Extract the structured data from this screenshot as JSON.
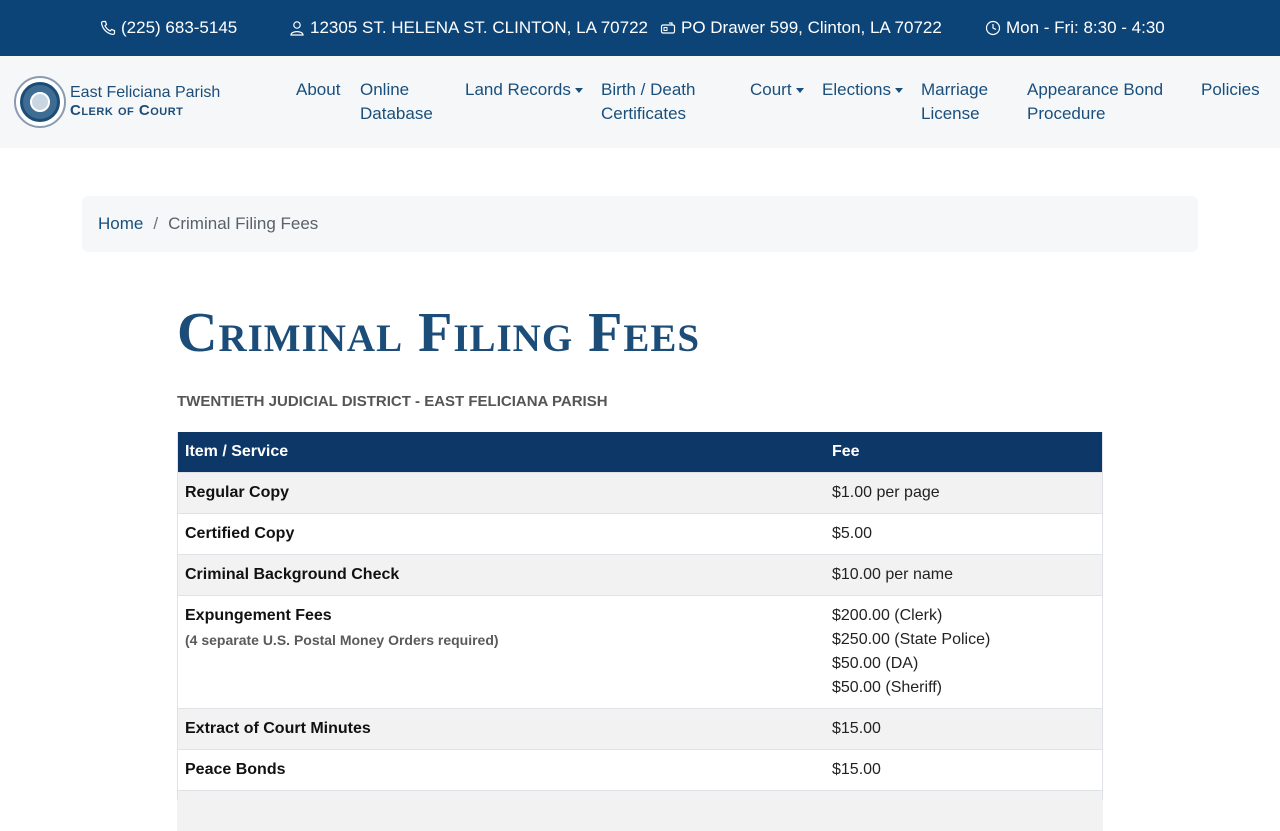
{
  "topbar": {
    "phone": "(225) 683-5145",
    "address": "12305 ST. HELENA ST. CLINTON, LA 70722",
    "mailing": "PO Drawer 599, Clinton, LA 70722",
    "hours": "Mon - Fri: 8:30 - 4:30"
  },
  "logo": {
    "line1": "East Feliciana Parish",
    "line2": "Clerk of Court"
  },
  "nav": {
    "about": "About",
    "online_database": "Online\nDatabase",
    "land_records": "Land Records",
    "birth_death": "Birth / Death\nCertificates",
    "court": "Court",
    "elections": "Elections",
    "marriage": "Marriage\nLicense",
    "appearance_bond": "Appearance Bond\nProcedure",
    "policies": "Policies"
  },
  "breadcrumb": {
    "home": "Home",
    "separator": "/",
    "current": "Criminal Filing Fees"
  },
  "page": {
    "title": "Criminal Filing Fees",
    "subtitle": "TWENTIETH JUDICIAL DISTRICT - EAST FELICIANA PARISH"
  },
  "table": {
    "headers": {
      "item": "Item / Service",
      "fee": "Fee"
    },
    "rows": [
      {
        "item": "Regular Copy",
        "fee": "$1.00 per page"
      },
      {
        "item": "Certified Copy",
        "fee": "$5.00"
      },
      {
        "item": "Criminal Background Check",
        "fee": "$10.00 per name"
      },
      {
        "item": "Expungement Fees",
        "note": "(4 separate U.S. Postal Money Orders required)",
        "fees": [
          "$200.00 (Clerk)",
          "$250.00 (State Police)",
          "$50.00 (DA)",
          "$50.00 (Sheriff)"
        ]
      },
      {
        "item": "Extract of Court Minutes",
        "fee": "$15.00"
      },
      {
        "item": "Peace Bonds",
        "fee": "$15.00"
      }
    ]
  },
  "colors": {
    "topbar": "#0d4477",
    "header_row": "#0d3767",
    "accent": "#1c4d78"
  }
}
